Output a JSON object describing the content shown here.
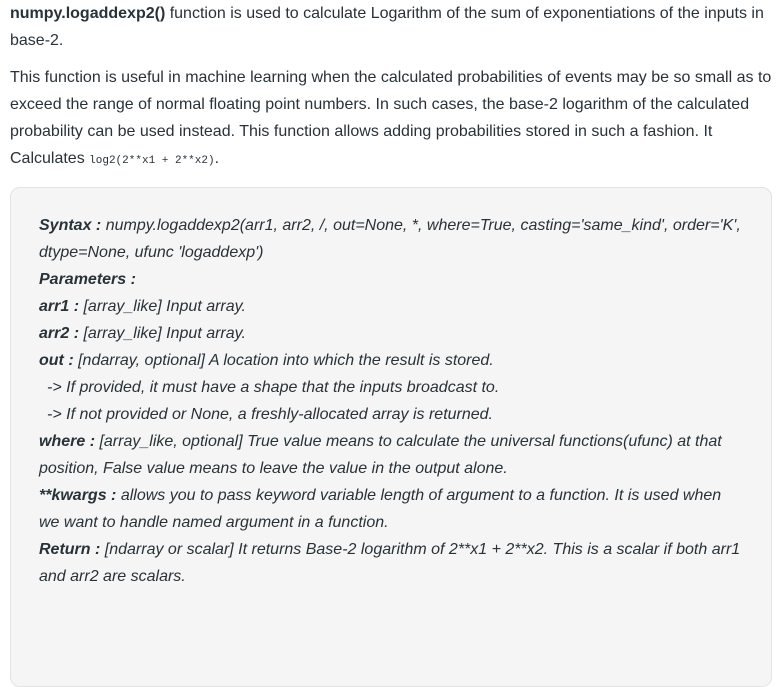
{
  "intro": {
    "fn_name": "numpy.logaddexp2()",
    "after_fn": " function is used to calculate Logarithm of the sum of exponentiations of the inputs in base-2."
  },
  "description": {
    "text": "This function is useful in machine learning when the calculated probabilities of events may be so small as to exceed the range of normal floating point numbers. In such cases, the base-2 logarithm of the calculated probability can be used instead. This function allows adding probabilities stored in such a fashion. It Calculates ",
    "code": "log2(2**x1 + 2**x2)",
    "end": "."
  },
  "box": {
    "syntax_label": "Syntax :",
    "syntax_text": " numpy.logaddexp2(arr1, arr2, /, out=None, *, where=True, casting='same_kind', order='K', dtype=None, ufunc 'logaddexp')",
    "params_title": "Parameters :",
    "params": [
      {
        "name": "arr1 :",
        "desc": " [array_like] Input array."
      },
      {
        "name": "arr2 :",
        "desc": " [array_like] Input array."
      },
      {
        "name": "out :",
        "desc": " [ndarray, optional] A location into which the result is stored."
      }
    ],
    "out_notes": [
      "-> If provided, it must have a shape that the inputs broadcast to.",
      "-> If not provided or None, a freshly-allocated array is returned."
    ],
    "where": {
      "name": "where :",
      "desc": " [array_like, optional] True value means to calculate the universal functions(ufunc) at that position, False value means to leave the value in the output alone."
    },
    "kwargs": {
      "name": "**kwargs :",
      "desc": " allows you to pass keyword variable length of argument to a function. It is used when we want to handle named argument in a function."
    },
    "return": {
      "name": "Return :",
      "desc": " [ndarray or scalar] It returns Base-2 logarithm of 2**x1 + 2**x2. This is a scalar if both arr1 and arr2 are scalars."
    }
  }
}
